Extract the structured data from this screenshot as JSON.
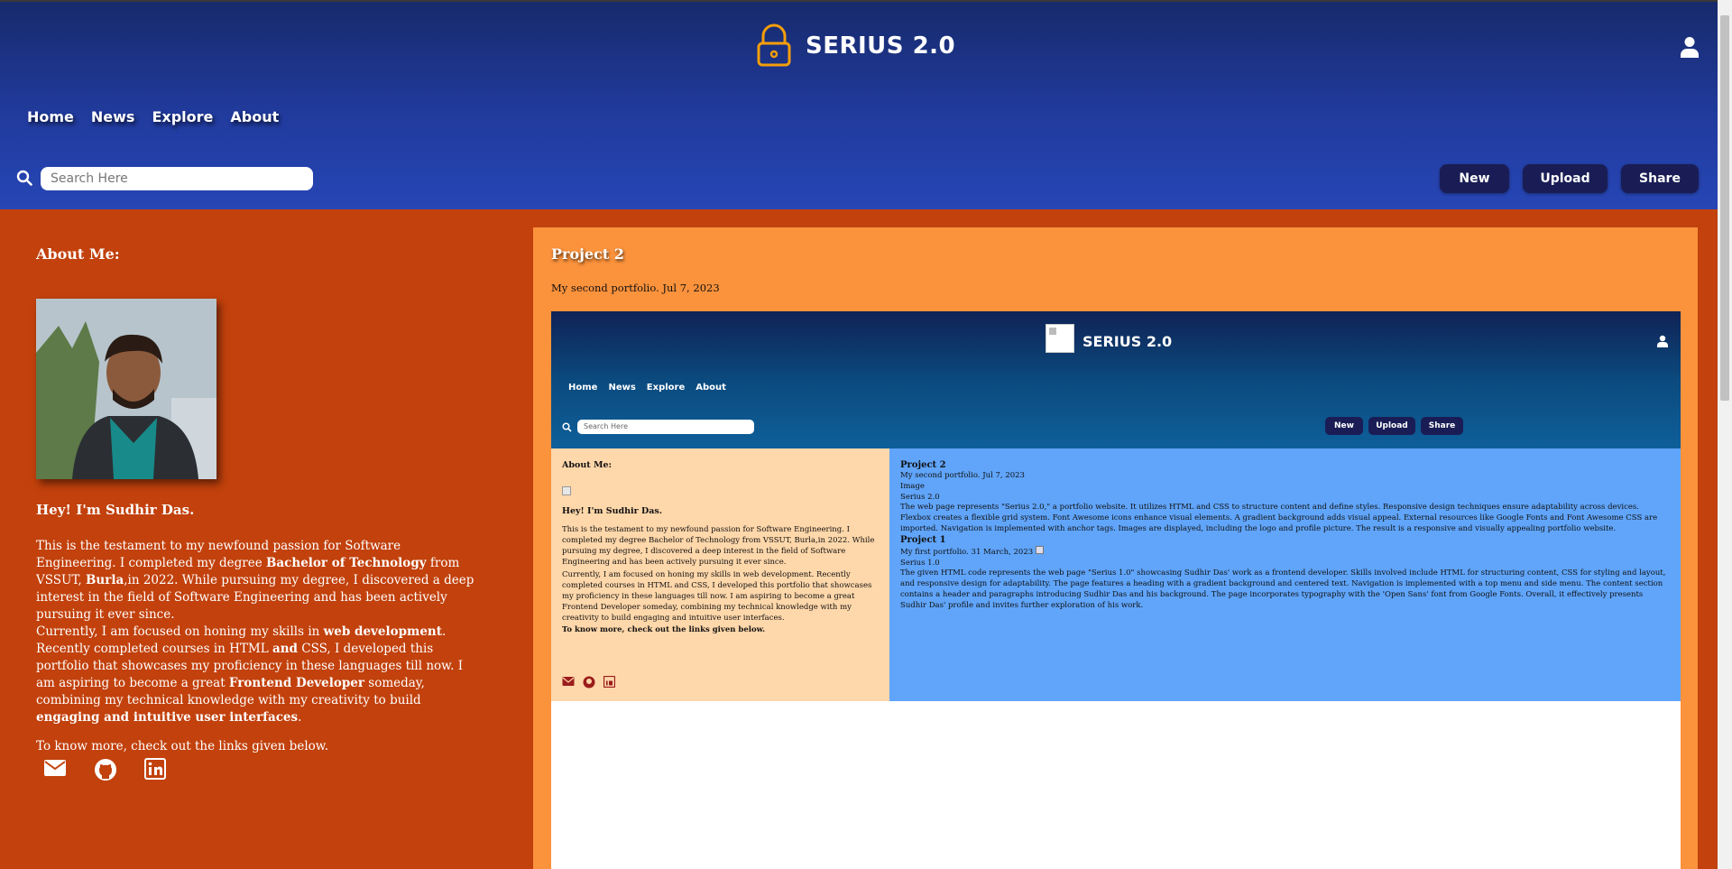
{
  "header": {
    "brand": "SERIUS 2.0",
    "logo_icon": "lock-icon",
    "user_icon": "user-icon",
    "nav": [
      "Home",
      "News",
      "Explore",
      "About"
    ],
    "search_placeholder": "Search Here",
    "buttons": {
      "new": "New",
      "upload": "Upload",
      "share": "Share"
    },
    "colors": {
      "gradient_top": "#172a6b",
      "gradient_bottom": "#2746b5",
      "button": "#1a1d55",
      "logo": "#f59e0b"
    }
  },
  "about": {
    "heading": "About Me:",
    "name_intro": "Hey! I'm Sudhir Das.",
    "p1_a": "This is the testament to my newfound passion for Software Engineering. I completed my degree ",
    "p1_b": "Bachelor of Technology",
    "p1_c": " from VSSUT, ",
    "p1_d": "Burla",
    "p1_e": ",in 2022. While pursuing my degree, I discovered a deep interest in the field of Software Engineering and has been actively pursuing it ever since.",
    "p2_a": "Currently, I am focused on honing my skills in ",
    "p2_b": "web development",
    "p2_c": ". Recently completed courses in HTML ",
    "p2_d": "and",
    "p2_e": " CSS, I developed this portfolio that showcases my proficiency in these languages till now. I am aspiring to become a great ",
    "p2_f": "Frontend Developer",
    "p2_g": " someday, combining my technical knowledge with my creativity to build ",
    "p2_h": "engaging and intuitive user interfaces",
    "p2_i": ".",
    "p3": "To know more, check out the links given below.",
    "social_icons": [
      "envelope-icon",
      "github-icon",
      "linkedin-icon"
    ],
    "background": "#c2410c"
  },
  "project": {
    "title": "Project 2",
    "subtitle": "My second portfolio. Jul 7, 2023",
    "background": "#fb923c"
  },
  "preview": {
    "brand": "SERIUS 2.0",
    "nav": [
      "Home",
      "News",
      "Explore",
      "About"
    ],
    "search_placeholder": "Search Here",
    "buttons": {
      "new": "New",
      "upload": "Upload",
      "share": "Share"
    },
    "left": {
      "heading": "About Me:",
      "name_intro": "Hey! I'm Sudhir Das.",
      "p1": "This is the testament to my newfound passion for Software Engineering. I completed my degree Bachelor of Technology from VSSUT, Burla,in 2022. While pursuing my degree, I discovered a deep interest in the field of Software Engineering and has been actively pursuing it ever since.",
      "p2": "Currently, I am focused on honing my skills in web development. Recently completed courses in HTML and CSS, I developed this portfolio that showcases my proficiency in these languages till now. I am aspiring to become a great Frontend Developer someday, combining my technical knowledge with my creativity to build engaging and intuitive user interfaces.",
      "p3": "To know more, check out the links given below."
    },
    "right": {
      "p2_title": "Project 2",
      "p2_sub": "My second portfolio. Jul 7, 2023",
      "p2_image": "Image",
      "p2_name": "Serius 2.0",
      "p2_desc": "The web page represents \"Serius 2.0,\" a portfolio website. It utilizes HTML and CSS to structure content and define styles. Responsive design techniques ensure adaptability across devices. Flexbox creates a flexible grid system. Font Awesome icons enhance visual elements. A gradient background adds visual appeal. External resources like Google Fonts and Font Awesome CSS are imported. Navigation is implemented with anchor tags. Images are displayed, including the logo and profile picture. The result is a responsive and visually appealing portfolio website.",
      "p1_title": "Project 1",
      "p1_sub": "My first portfolio. 31 March, 2023",
      "p1_name": "Serius 1.0",
      "p1_desc": "The given HTML code represents the web page \"Serius 1.0\" showcasing Sudhir Das' work as a frontend developer. Skills involved include HTML for structuring content, CSS for styling and layout, and responsive design for adaptability. The page features a heading with a gradient background and centered text. Navigation is implemented with a top menu and side menu. The content section contains a header and paragraphs introducing Sudhir Das and his background. The page incorporates typography with the 'Open Sans' font from Google Fonts. Overall, it effectively presents Sudhir Das' profile and invites further exploration of his work."
    }
  }
}
